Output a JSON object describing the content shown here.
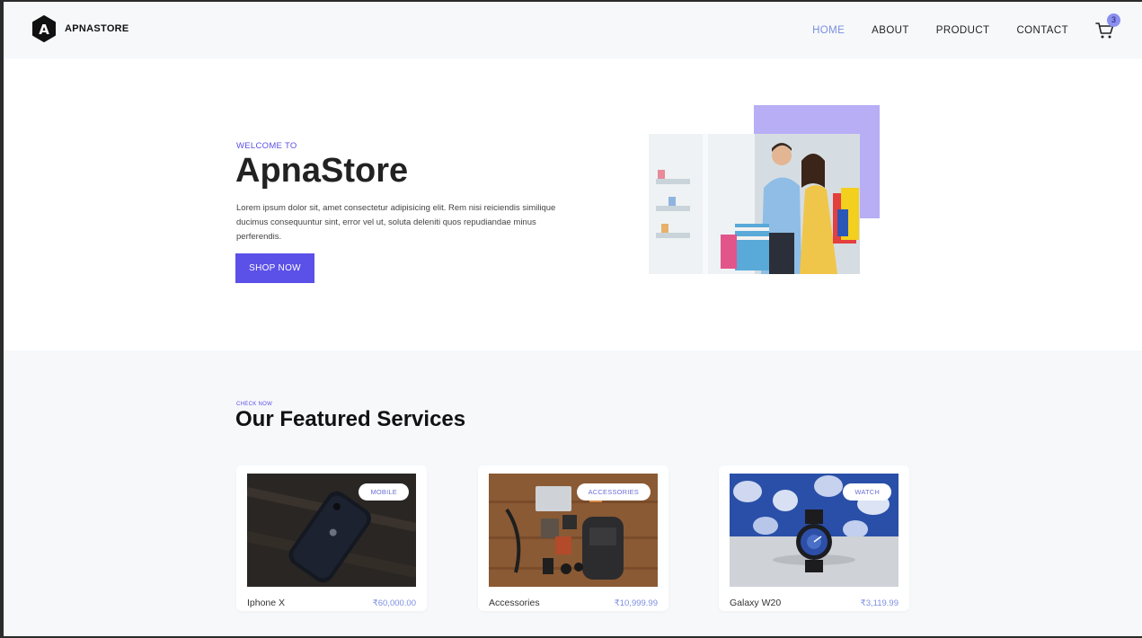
{
  "brand": {
    "name": "APNASTORE",
    "logo_letter": "A"
  },
  "nav": {
    "items": [
      {
        "label": "HOME",
        "active": true
      },
      {
        "label": "ABOUT",
        "active": false
      },
      {
        "label": "PRODUCT",
        "active": false
      },
      {
        "label": "CONTACT",
        "active": false
      }
    ],
    "cart_count": "3"
  },
  "hero": {
    "eyebrow": "WELCOME TO",
    "title": "ApnaStore",
    "description": "Lorem ipsum dolor sit, amet consectetur adipisicing elit. Rem nisi reiciendis similique ducimus consequuntur sint, error vel ut, soluta deleniti quos repudiandae minus perferendis.",
    "cta_label": "SHOP NOW"
  },
  "services": {
    "eyebrow": "CHECK NOW",
    "title": "Our Featured Services",
    "cards": [
      {
        "tag": "MOBILE",
        "name": "Iphone X",
        "price": "₹60,000.00"
      },
      {
        "tag": "ACCESSORIES",
        "name": "Accessories",
        "price": "₹10,999.99"
      },
      {
        "tag": "WATCH",
        "name": "Galaxy W20",
        "price": "₹3,119.99"
      }
    ]
  },
  "colors": {
    "accent": "#5b50e8",
    "nav_active": "#7b8fe0",
    "hero_accent_block": "#b7aef5",
    "section_bg": "#f6f8fa"
  }
}
